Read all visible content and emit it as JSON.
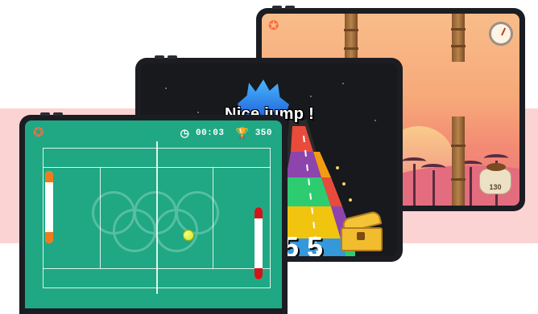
{
  "back_game": {
    "bag_count": "130",
    "icons": [
      "star-icon",
      "clock-icon",
      "coin-bag-icon"
    ]
  },
  "mid_game": {
    "message": "Nice jump !",
    "score_partial": "5 5",
    "icons": [
      "treasure-chest-icon",
      "crystal-castle-icon"
    ]
  },
  "front_game": {
    "timer": "00:03",
    "score": "350",
    "icons": [
      "star-icon",
      "clock-icon",
      "trophy-icon",
      "tennis-ball-icon"
    ],
    "colors": {
      "court": "#1fa883",
      "left_paddle": "#f07b1a",
      "right_paddle": "#d3151b"
    }
  }
}
